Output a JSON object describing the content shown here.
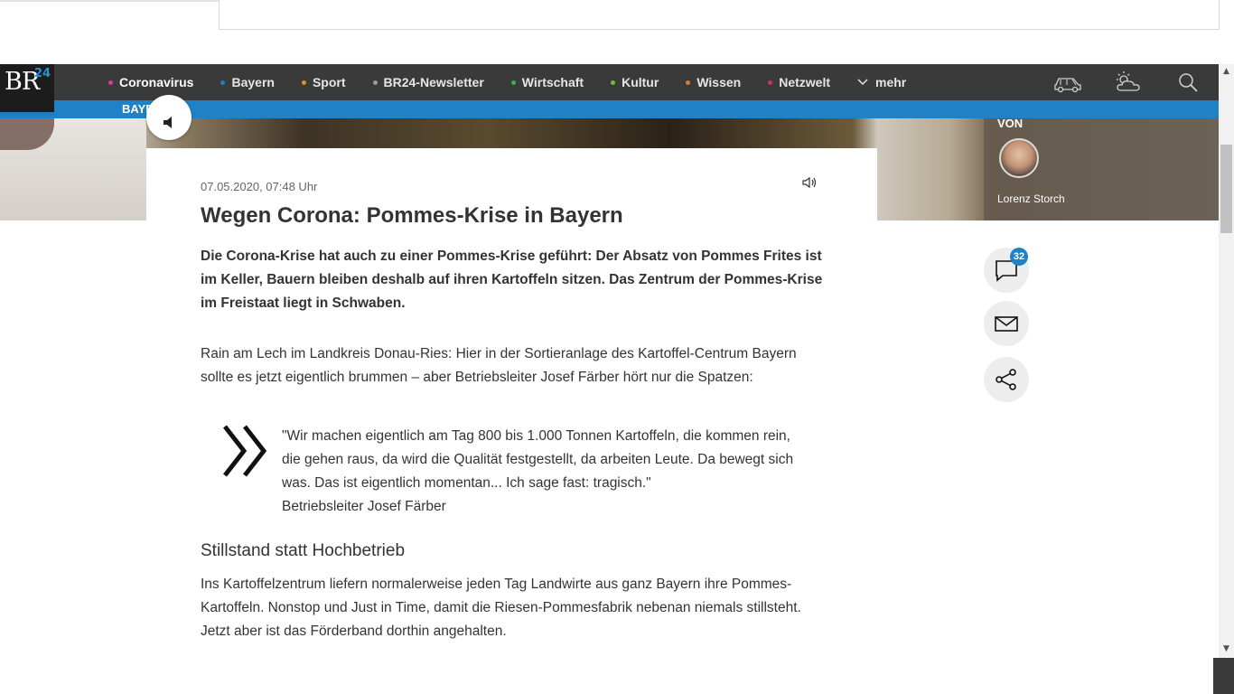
{
  "site": {
    "logo_text": "BR",
    "logo_suffix": "24",
    "brand_color": "#1f82c6"
  },
  "nav": {
    "items": [
      {
        "label": "Coronavirus",
        "dot_color": "#d63ab0"
      },
      {
        "label": "Bayern",
        "dot_color": "#1f82c6"
      },
      {
        "label": "Sport",
        "dot_color": "#e0902a"
      },
      {
        "label": "BR24-Newsletter",
        "dot_color": "#9a9a9a"
      },
      {
        "label": "Wirtschaft",
        "dot_color": "#3cae5a"
      },
      {
        "label": "Kultur",
        "dot_color": "#7ab833"
      },
      {
        "label": "Wissen",
        "dot_color": "#e07a2a"
      },
      {
        "label": "Netzwelt",
        "dot_color": "#d0306a"
      }
    ],
    "more_label": "mehr",
    "icons": [
      "traffic-car-icon",
      "weather-icon",
      "search-icon"
    ]
  },
  "subnav": {
    "label": "BAYERN"
  },
  "author": {
    "heading": "VON",
    "name": "Lorenz Storch"
  },
  "article": {
    "date": "07.05.2020, 07:48 Uhr",
    "title": "Wegen Corona: Pommes-Krise in Bayern",
    "teaser": "Die Corona-Krise hat auch zu einer Pommes-Krise geführt: Der Absatz von Pommes Frites ist im Keller, Bauern bleiben deshalb auf ihren Kartoffeln sitzen. Das Zentrum der Pommes-Krise im Freistaat liegt in Schwaben.",
    "para1": "Rain am Lech im Landkreis Donau-Ries: Hier in der Sortieranlage des Kartoffel-Centrum Bayern sollte es jetzt eigentlich brummen – aber Betriebsleiter Josef Färber hört nur die Spatzen:",
    "quote": "\"Wir machen eigentlich am Tag 800 bis 1.000 Tonnen Kartoffeln, die kommen rein, die gehen raus, da wird die Qualität festgestellt, da arbeiten Leute. Da bewegt sich was. Das ist eigentlich momentan... Ich sage fast: tragisch.\"",
    "quote_source": "Betriebsleiter Josef Färber",
    "subheading": "Stillstand statt Hochbetrieb",
    "para2": "Ins Kartoffelzentrum liefern normalerweise jeden Tag Landwirte aus ganz Bayern ihre Pommes-Kartoffeln. Nonstop und Just in Time, damit die Riesen-Pommesfabrik nebenan niemals stillsteht. Jetzt aber ist das Förderband dorthin angehalten."
  },
  "actions": {
    "comment_count": "32",
    "icons": [
      "comment-icon",
      "mail-icon",
      "share-icon"
    ]
  }
}
